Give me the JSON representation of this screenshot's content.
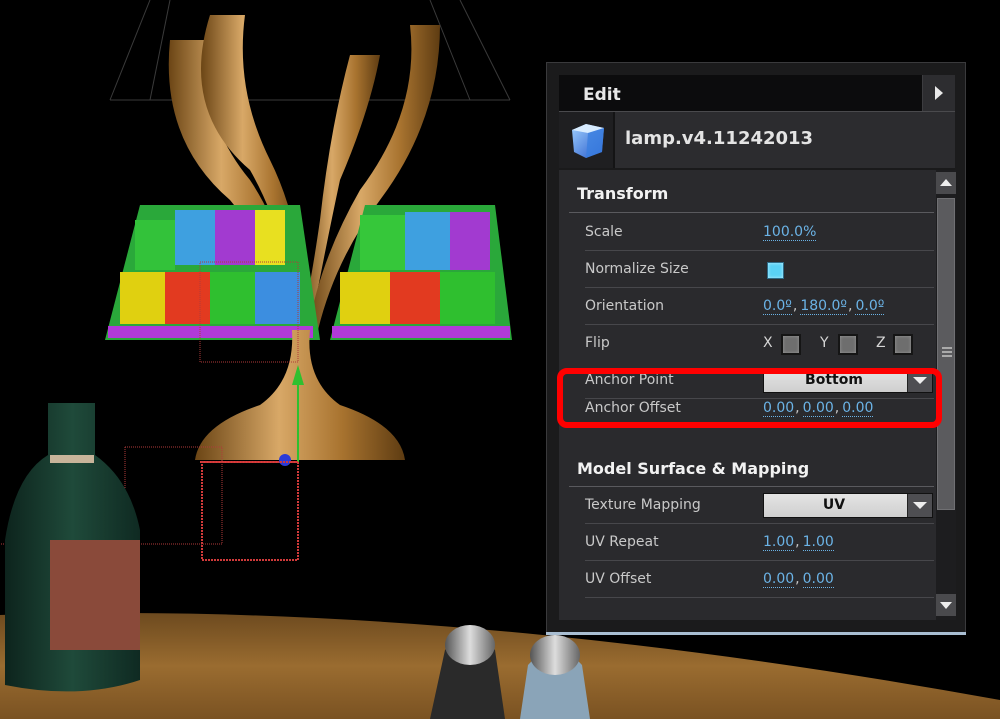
{
  "panel": {
    "header_title": "Edit",
    "expand_icon": "triangle-right-icon",
    "object_icon": "cube-icon",
    "object_name": "lamp.v4.11242013"
  },
  "transform": {
    "title": "Transform",
    "scale": {
      "label": "Scale",
      "value": "100.0%"
    },
    "normalize_size": {
      "label": "Normalize Size",
      "checked": true
    },
    "orientation": {
      "label": "Orientation",
      "x": "0.0º",
      "y": "180.0º",
      "z": "0.0º",
      "separator": ","
    },
    "flip": {
      "label": "Flip",
      "x_label": "X",
      "y_label": "Y",
      "z_label": "Z",
      "x": false,
      "y": false,
      "z": false
    },
    "anchor_point": {
      "label": "Anchor Point",
      "value": "Bottom"
    },
    "anchor_offset": {
      "label": "Anchor Offset",
      "x": "0.00",
      "y": "0.00",
      "z": "0.00",
      "separator": ","
    }
  },
  "surface": {
    "title": "Model Surface & Mapping",
    "texture_mapping": {
      "label": "Texture Mapping",
      "value": "UV"
    },
    "uv_repeat": {
      "label": "UV Repeat",
      "u": "1.00",
      "v": "1.00",
      "separator": ","
    },
    "uv_offset": {
      "label": "UV Offset",
      "u": "0.00",
      "v": "0.00",
      "separator": ","
    }
  },
  "highlight_color": "#ff0000",
  "accent_color": "#6bb3e6"
}
